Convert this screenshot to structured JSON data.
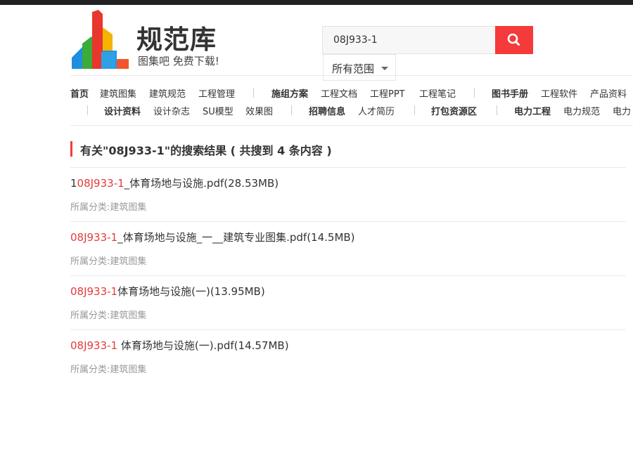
{
  "brand": {
    "name": "规范库",
    "slogan": "图集吧 免费下载!"
  },
  "search": {
    "value": "08J933-1",
    "scope": "所有范围"
  },
  "nav_row1": [
    {
      "label": "首页",
      "bold": true
    },
    {
      "label": "建筑图集",
      "bold": false
    },
    {
      "label": "建筑规范",
      "bold": false
    },
    {
      "label": "工程管理",
      "bold": false
    },
    {
      "label": "施组方案",
      "bold": true
    },
    {
      "label": "工程文档",
      "bold": false
    },
    {
      "label": "工程PPT",
      "bold": false
    },
    {
      "label": "工程笔记",
      "bold": false
    },
    {
      "label": "图书手册",
      "bold": true
    },
    {
      "label": "工程软件",
      "bold": false
    },
    {
      "label": "产品资料",
      "bold": false
    }
  ],
  "nav_row2": [
    {
      "label": "设计资料",
      "bold": true
    },
    {
      "label": "设计杂志",
      "bold": false
    },
    {
      "label": "SU模型",
      "bold": false
    },
    {
      "label": "效果图",
      "bold": false
    },
    {
      "label": "招聘信息",
      "bold": true
    },
    {
      "label": "人才简历",
      "bold": false
    },
    {
      "label": "打包资源区",
      "bold": true
    },
    {
      "label": "电力工程",
      "bold": true
    },
    {
      "label": "电力规范",
      "bold": false
    },
    {
      "label": "电力",
      "bold": false
    }
  ],
  "results_heading": "有关\"08J933-1\"的搜索结果 ( 共搜到 4 条内容 )",
  "results": [
    {
      "prefix": "1",
      "highlight": "08J933-1",
      "rest": "_体育场地与设施.pdf(28.53MB)",
      "category_label": "所属分类:",
      "category": "建筑图集"
    },
    {
      "prefix": "",
      "highlight": "08J933-1",
      "rest": "_体育场地与设施_一__建筑专业图集.pdf(14.5MB)",
      "category_label": "所属分类:",
      "category": "建筑图集"
    },
    {
      "prefix": "",
      "highlight": "08J933-1",
      "rest": "体育场地与设施(一)(13.95MB)",
      "category_label": "所属分类:",
      "category": "建筑图集"
    },
    {
      "prefix": "",
      "highlight": "08J933-1",
      "rest": " 体育场地与设施(一).pdf(14.57MB)",
      "category_label": "所属分类:",
      "category": "建筑图集"
    }
  ],
  "colors": {
    "accent": "#f43a3a",
    "highlight": "#e43b3b",
    "logo_red": "#e8372c",
    "logo_green": "#3bab3a",
    "logo_blue": "#1d8fe0",
    "logo_yellow": "#f5b400",
    "logo_orange": "#f2552c"
  },
  "icons": {
    "search": "search-icon",
    "dropdown": "caret-down-icon"
  }
}
